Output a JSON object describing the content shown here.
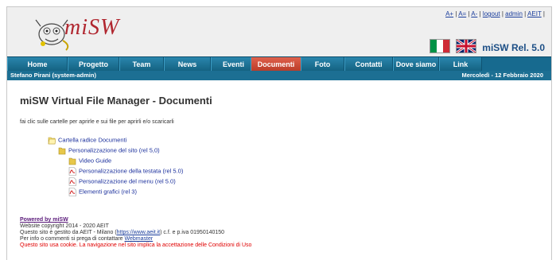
{
  "header": {
    "logo_text": "miSW",
    "top_links": [
      "A+",
      "A=",
      "A-",
      "logout",
      "admin",
      "AEIT"
    ],
    "release": "miSW Rel. 5.0"
  },
  "nav": {
    "items": [
      "Home",
      "Progetto",
      "Team",
      "News",
      "Eventi",
      "Documenti",
      "Foto",
      "Contatti",
      "Dove siamo",
      "Link"
    ],
    "active": "Documenti"
  },
  "userbar": {
    "user": "Stefano Pirani (system-admin)",
    "date": "Mercoledì - 12 Febbraio 2020"
  },
  "main": {
    "title": "miSW Virtual File Manager - Documenti",
    "hint": "fai clic sulle cartelle per aprirle e sui file per aprirli e/o scaricarli",
    "tree": [
      {
        "label": "Cartella radice Documenti",
        "icon": "folder-open-icon"
      },
      {
        "label": "Personalizzazione del sito (rel 5,0)",
        "icon": "folder-icon"
      },
      {
        "label": "Video Guide",
        "icon": "folder-icon"
      },
      {
        "label": "Personalizzazione della testata (rel 5.0)",
        "icon": "pdf-file-icon"
      },
      {
        "label": "Personalizzazione del menu (rel 5.0)",
        "icon": "pdf-file-icon"
      },
      {
        "label": "Elementi grafici (rel 3)",
        "icon": "pdf-file-icon"
      }
    ]
  },
  "footer": {
    "powered": "Powered by miSW",
    "copyright": "Website copyright 2014 - 2020 AEIT",
    "managed_prefix": "Questo sito è gestito da AEIT - Milano (",
    "managed_link": "https://www.aeit.it",
    "managed_suffix": ") c.f. e p.iva 01950140150",
    "contact_prefix": "Per info o commenti si prega di contattare ",
    "contact_link": "Webmaster",
    "cookie": "Questo sito usa cookie. La navigazione nel sito implica la accettazione delle Condizioni di Uso"
  },
  "colors": {
    "nav": "#176a8f",
    "nav_active": "#c8432f",
    "link": "#1a2f9c",
    "cookie": "#e00000"
  }
}
